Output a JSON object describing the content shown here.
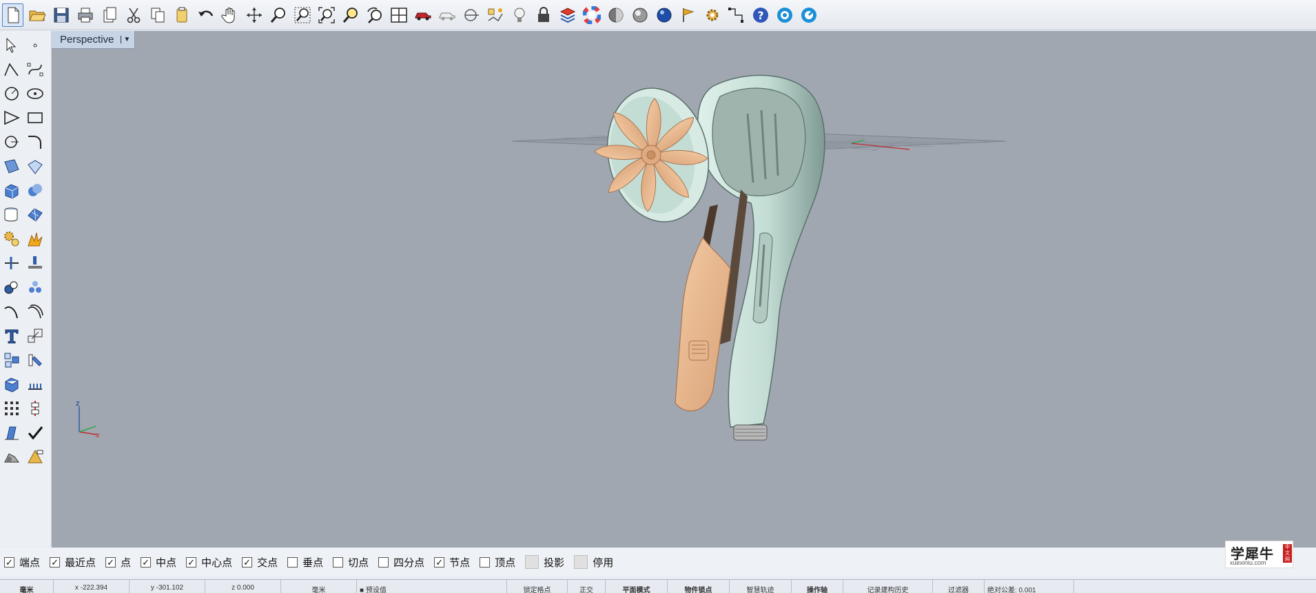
{
  "toolbar": {
    "icons": [
      "new-file-icon",
      "open-folder-icon",
      "save-icon",
      "print-icon",
      "import-icon",
      "cut-icon",
      "copy-icon",
      "paste-icon",
      "undo-icon",
      "pan-hand-icon",
      "rotate-view-icon",
      "zoom-dynamic-icon",
      "zoom-window-icon",
      "zoom-extents-icon",
      "zoom-selected-icon",
      "undo-view-icon",
      "four-viewports-icon",
      "car-render-icon",
      "car-wireframe-icon",
      "cplane-icon",
      "named-cplane-icon",
      "light-bulb-icon",
      "lock-icon",
      "layer-icon",
      "color-wheel-icon",
      "shaded-sphere-icon",
      "rendered-sphere-icon",
      "render-sphere-blue-icon",
      "options-flag-icon",
      "gear-icon",
      "osnap-icon",
      "help-icon",
      "rhino-render-icon",
      "rhino-settings-icon"
    ]
  },
  "viewport": {
    "tab_label": "Perspective",
    "axis_labels": {
      "z": "z",
      "x": "x",
      "y": "y"
    }
  },
  "snapbar": {
    "items": [
      {
        "label": "端点",
        "checked": true
      },
      {
        "label": "最近点",
        "checked": true
      },
      {
        "label": "点",
        "checked": true
      },
      {
        "label": "中点",
        "checked": true
      },
      {
        "label": "中心点",
        "checked": true
      },
      {
        "label": "交点",
        "checked": true
      },
      {
        "label": "垂点",
        "checked": false
      },
      {
        "label": "切点",
        "checked": false
      },
      {
        "label": "四分点",
        "checked": false
      },
      {
        "label": "节点",
        "checked": true
      },
      {
        "label": "顶点",
        "checked": false
      },
      {
        "label": "投影",
        "checked": false,
        "gray": true
      },
      {
        "label": "停用",
        "checked": false,
        "gray": true
      }
    ]
  },
  "statusbar": {
    "cells": [
      "毫米",
      "x -222.394",
      "y -301.102",
      "z 0.000",
      "毫米",
      "■ 预设值",
      "锁定格点",
      "正交",
      "平面模式",
      "物件锁点",
      "智慧轨迹",
      "操作轴",
      "记录建构历史",
      "过滤器",
      "绝对公差: 0.001"
    ]
  },
  "watermark": {
    "title": "学犀牛",
    "url": "xuexiniu.com",
    "badge": "中文网"
  },
  "colors": {
    "viewport_bg": "#a0a7b1",
    "accent": "#4b7fc1",
    "body": "#c7dfd8",
    "petal": "#e8b98f"
  }
}
